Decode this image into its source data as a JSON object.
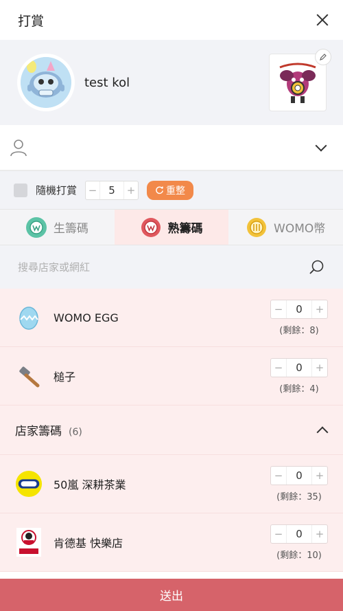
{
  "header": {
    "title": "打賞"
  },
  "profile": {
    "name": "test kol"
  },
  "random": {
    "label": "隨機打賞",
    "quantity": "5",
    "reset_label": "重整"
  },
  "tabs": [
    {
      "label": "生籌碼",
      "active": false
    },
    {
      "label": "熟籌碼",
      "active": true
    },
    {
      "label": "WOMO幣",
      "active": false
    }
  ],
  "search": {
    "placeholder": "搜尋店家或網紅"
  },
  "items": [
    {
      "name": "WOMO EGG",
      "qty": "0",
      "remain": "(剩餘：8)"
    },
    {
      "name": "槌子",
      "qty": "0",
      "remain": "(剩餘：4)"
    }
  ],
  "store_section": {
    "title": "店家籌碼",
    "count": "(6)"
  },
  "stores": [
    {
      "name": "50嵐 深耕茶業",
      "qty": "0",
      "remain": "(剩餘：35)"
    },
    {
      "name": "肯德基 快樂店",
      "qty": "0",
      "remain": "(剩餘：10)"
    }
  ],
  "stepper": {
    "minus": "−",
    "plus": "+"
  },
  "submit": {
    "label": "送出"
  },
  "colors": {
    "accent": "#d6636a",
    "reset": "#f2894a",
    "active_tab": "#fde9e8",
    "list_bg": "#fdeeee"
  }
}
